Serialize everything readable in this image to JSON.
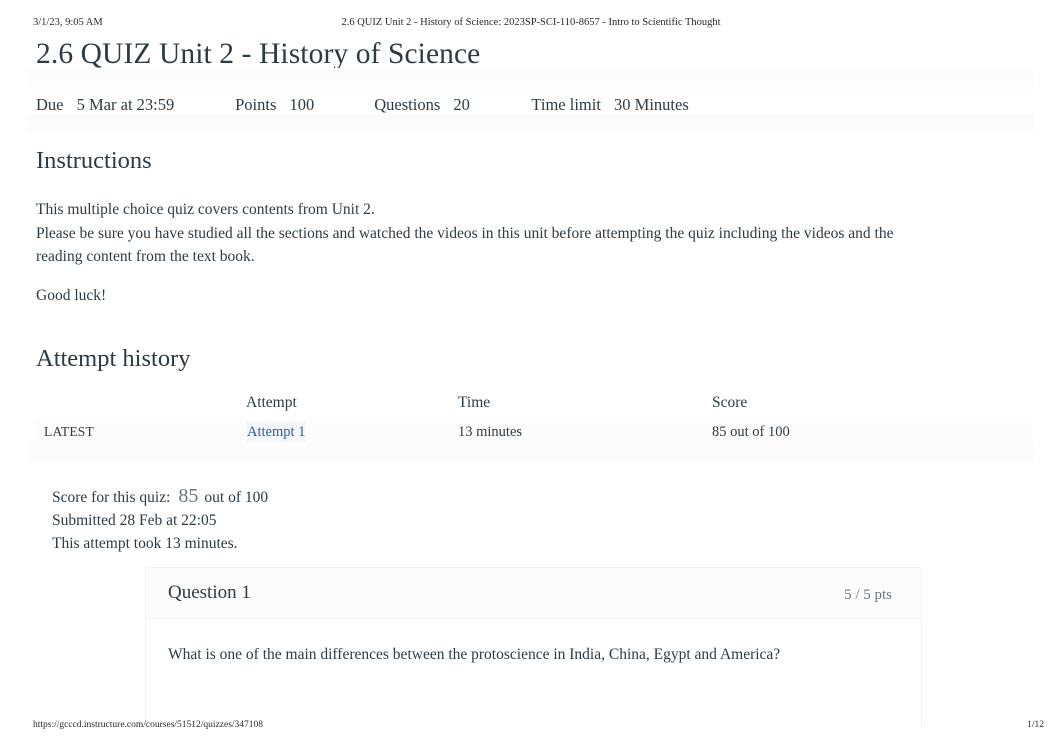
{
  "print_header": {
    "timestamp": "3/1/23, 9:05 AM",
    "document_title": "2.6 QUIZ Unit 2 - History of Science: 2023SP-SCI-110-8657 - Intro to Scientific Thought"
  },
  "print_footer": {
    "url": "https://gcccd.instructure.com/courses/51512/quizzes/347108",
    "page_number": "1/12"
  },
  "quiz": {
    "title": "2.6 QUIZ Unit 2 - History of Science",
    "info": {
      "due_label": "Due",
      "due_value": "5 Mar at 23:59",
      "points_label": "Points",
      "points_value": "100",
      "questions_label": "Questions",
      "questions_value": "20",
      "time_limit_label": "Time limit",
      "time_limit_value": "30 Minutes"
    }
  },
  "instructions": {
    "heading": "Instructions",
    "paragraph_1": "This multiple choice quiz covers contents from Unit 2.",
    "paragraph_2": "Please be sure you have studied all the sections and watched the videos in this unit before attempting the quiz including the videos and the reading content from the text book.",
    "paragraph_3": "Good luck!"
  },
  "attempt_history": {
    "heading": "Attempt history",
    "columns": [
      "",
      "Attempt",
      "Time",
      "Score"
    ],
    "rows": [
      {
        "marker": "LATEST",
        "attempt": "Attempt 1",
        "time": "13 minutes",
        "score": "85 out of 100"
      }
    ]
  },
  "score_summary": {
    "score_label": "Score for this quiz:",
    "score_value": "85",
    "score_out_of": "out of 100",
    "submitted": "Submitted 28 Feb at 22:05",
    "duration": "This attempt took 13 minutes."
  },
  "question": {
    "name": "Question 1",
    "points": "5 / 5 pts",
    "text": "What is one of the main differences between the protoscience in India, China, Egypt and America?"
  },
  "colors": {
    "link": "#2c5c9b",
    "text": "#2d3b45",
    "muted": "#6b7780",
    "row_background": "#fcfcfc"
  }
}
